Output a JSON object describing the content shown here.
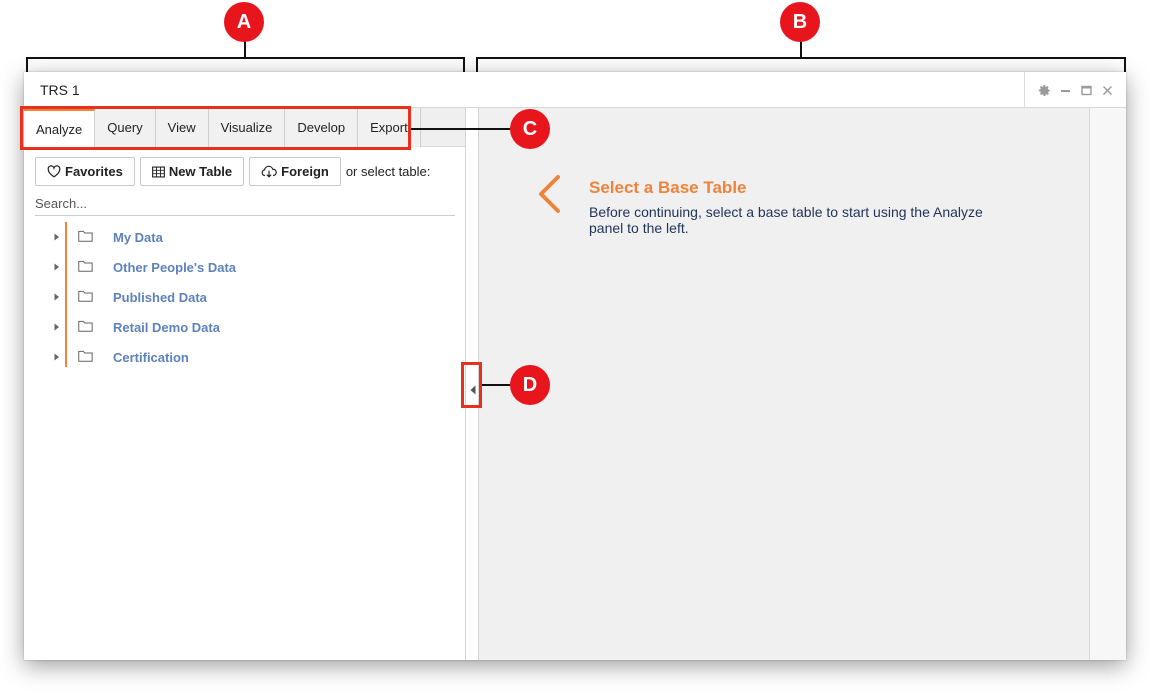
{
  "annotations": {
    "a": "A",
    "b": "B",
    "c": "C",
    "d": "D"
  },
  "window": {
    "title": "TRS 1",
    "controls": [
      "gear-icon",
      "minimize-icon",
      "maximize-icon",
      "close-icon"
    ]
  },
  "tabs": [
    {
      "label": "Analyze",
      "active": true
    },
    {
      "label": "Query",
      "active": false
    },
    {
      "label": "View",
      "active": false
    },
    {
      "label": "Visualize",
      "active": false
    },
    {
      "label": "Develop",
      "active": false
    },
    {
      "label": "Export",
      "active": false
    }
  ],
  "toolbar": {
    "favorites_label": "Favorites",
    "new_table_label": "New Table",
    "foreign_label": "Foreign",
    "select_label": "or select table:"
  },
  "search": {
    "placeholder": "Search..."
  },
  "tree": [
    {
      "label": "My Data"
    },
    {
      "label": "Other People's Data"
    },
    {
      "label": "Published Data"
    },
    {
      "label": "Retail Demo Data"
    },
    {
      "label": "Certification"
    }
  ],
  "main": {
    "title": "Select a Base Table",
    "description": "Before continuing, select a base table to start using the Analyze panel to the left."
  },
  "colors": {
    "accent": "#f0833a",
    "callout": "#e8151c",
    "link": "#5d82be",
    "text_dark": "#1f3358"
  }
}
